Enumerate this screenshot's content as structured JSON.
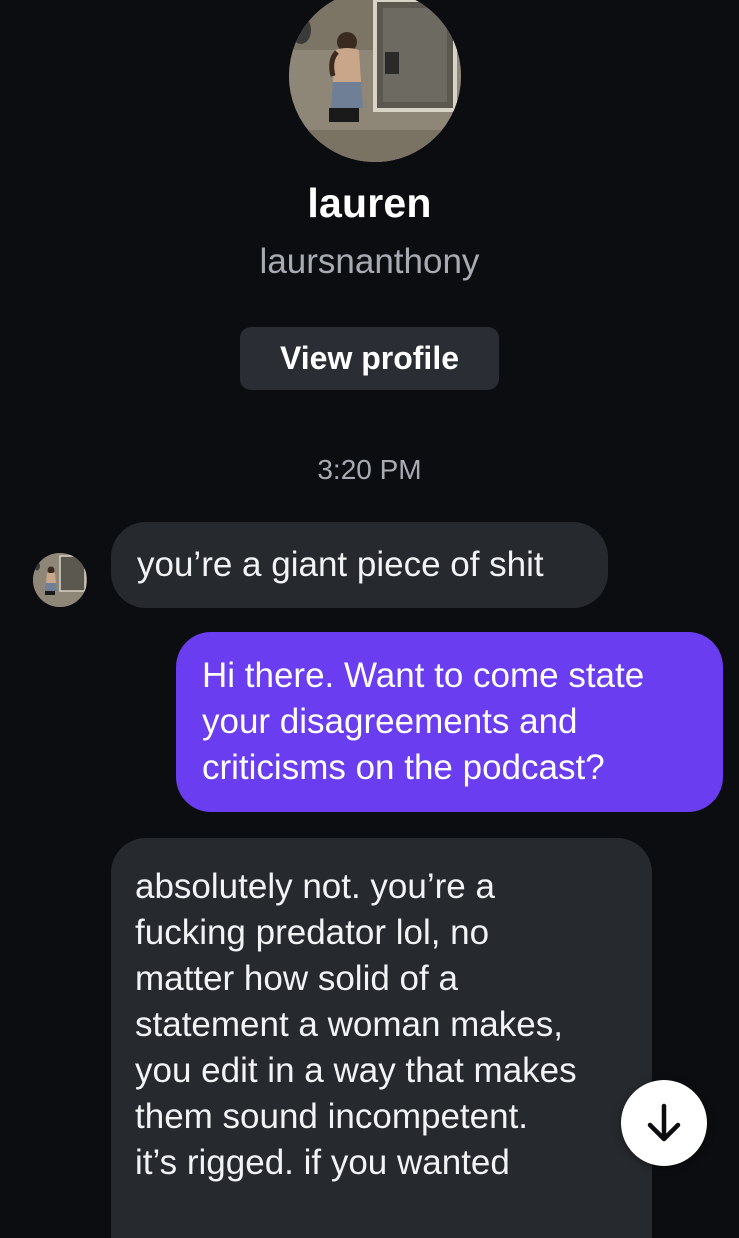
{
  "profile": {
    "name": "lauren",
    "handle": "laursnanthony",
    "view_profile_label": "View profile"
  },
  "conversation": {
    "timestamp": "3:20 PM",
    "messages": [
      {
        "sender": "lauren",
        "lines": [
          "you’re a giant piece of shit"
        ]
      },
      {
        "sender": "self",
        "lines": [
          "Hi there. Want to come state",
          "your disagreements and",
          "criticisms on the podcast?"
        ]
      },
      {
        "sender": "lauren",
        "lines": [
          "absolutely not. you’re a",
          "fucking predator lol, no",
          "matter how solid of a",
          "statement a woman makes,",
          "you edit in a way that makes",
          "them sound incompetent.",
          "it’s rigged. if you wanted"
        ]
      }
    ]
  },
  "icons": {
    "scroll_down": "arrow-down-icon",
    "avatar": "profile-photo"
  },
  "colors": {
    "background": "#0c0d10",
    "incoming_bubble": "#26292e",
    "outgoing_bubble": "#6a3df1",
    "secondary_text": "#a7abb3"
  }
}
